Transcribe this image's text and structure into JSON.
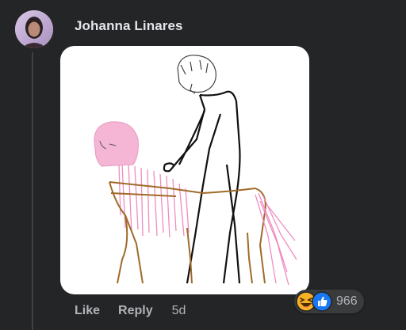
{
  "comment": {
    "author": "Johanna Linares",
    "actions": {
      "like_label": "Like",
      "reply_label": "Reply",
      "timestamp": "5d"
    },
    "reactions": {
      "icons": [
        "haha-icon",
        "like-icon"
      ],
      "count": "966"
    }
  },
  "colors": {
    "background": "#242526",
    "author_text": "#e4e6eb",
    "secondary_text": "#b0b3b8",
    "reaction_pill": "#3a3b3c",
    "like_blue": "#1877f2",
    "haha_yellow": "#f7b125"
  }
}
